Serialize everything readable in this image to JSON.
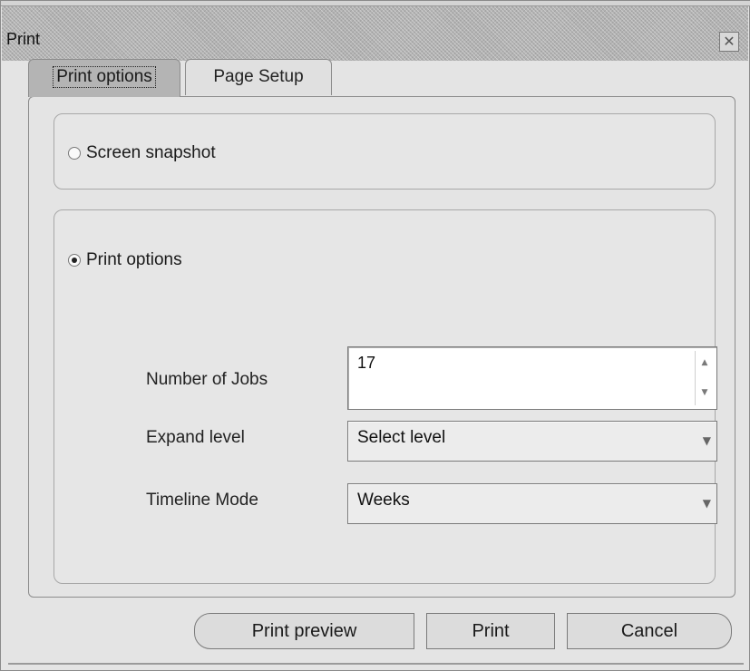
{
  "window": {
    "title": "Print",
    "close_symbol": "✕"
  },
  "tabs": [
    {
      "label": "Print options",
      "active": true
    },
    {
      "label": "Page Setup",
      "active": false
    }
  ],
  "options": {
    "screen_snapshot": {
      "label": "Screen snapshot",
      "selected": false
    },
    "print_options": {
      "label": "Print options",
      "selected": true
    }
  },
  "fields": {
    "jobs": {
      "label": "Number of Jobs",
      "value": "17"
    },
    "expand": {
      "label": "Expand level",
      "value": "Select level"
    },
    "timeline": {
      "label": "Timeline Mode",
      "value": "Weeks"
    }
  },
  "buttons": {
    "preview": "Print preview",
    "print": "Print",
    "cancel": "Cancel"
  },
  "icons": {
    "spin_up": "▲",
    "spin_down": "▼",
    "dropdown": "▼"
  }
}
